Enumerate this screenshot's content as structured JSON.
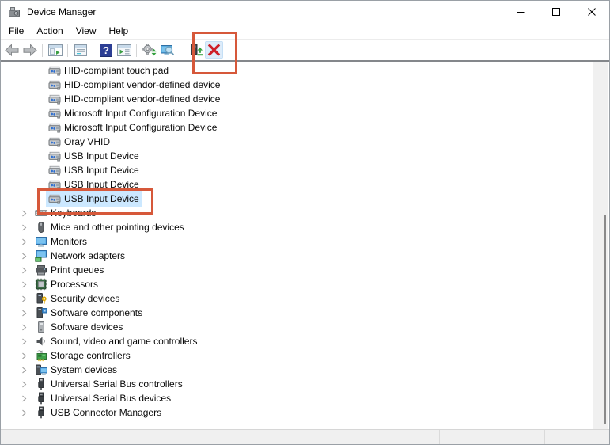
{
  "titlebar": {
    "title": "Device Manager",
    "app_icon": "device-manager",
    "controls": [
      {
        "icon": "minimize"
      },
      {
        "icon": "maximize"
      },
      {
        "icon": "close"
      }
    ]
  },
  "menubar": {
    "items": [
      "File",
      "Action",
      "View",
      "Help"
    ]
  },
  "toolbar": {
    "items": [
      {
        "type": "button",
        "icon": "back-arrow"
      },
      {
        "type": "button",
        "icon": "forward-arrow"
      },
      {
        "type": "separator"
      },
      {
        "type": "button",
        "icon": "console-tree"
      },
      {
        "type": "separator"
      },
      {
        "type": "button",
        "icon": "properties"
      },
      {
        "type": "separator"
      },
      {
        "type": "button",
        "icon": "help"
      },
      {
        "type": "button",
        "icon": "action-pane"
      },
      {
        "type": "separator"
      },
      {
        "type": "button",
        "icon": "scan-hardware"
      },
      {
        "type": "button",
        "icon": "remote-support"
      },
      {
        "type": "separator"
      },
      {
        "type": "button",
        "icon": "update-driver",
        "spaced": true
      },
      {
        "type": "button",
        "icon": "uninstall-device",
        "highlighted": true
      }
    ]
  },
  "tree": {
    "items": [
      {
        "label": "HID-compliant touch pad",
        "icon": "hid-device",
        "level": 2
      },
      {
        "label": "HID-compliant vendor-defined device",
        "icon": "hid-device",
        "level": 2
      },
      {
        "label": "HID-compliant vendor-defined device",
        "icon": "hid-device",
        "level": 2
      },
      {
        "label": "Microsoft Input Configuration Device",
        "icon": "hid-device",
        "level": 2
      },
      {
        "label": "Microsoft Input Configuration Device",
        "icon": "hid-device",
        "level": 2
      },
      {
        "label": "Oray VHID",
        "icon": "hid-device",
        "level": 2
      },
      {
        "label": "USB Input Device",
        "icon": "hid-device",
        "level": 2
      },
      {
        "label": "USB Input Device",
        "icon": "hid-device",
        "level": 2
      },
      {
        "label": "USB Input Device",
        "icon": "hid-device",
        "level": 2
      },
      {
        "label": "USB Input Device",
        "icon": "hid-device",
        "level": 2,
        "selected": true,
        "annotated": true
      },
      {
        "label": "Keyboards",
        "icon": "keyboard",
        "level": 1,
        "expandable": true
      },
      {
        "label": "Mice and other pointing devices",
        "icon": "mouse",
        "level": 1,
        "expandable": true
      },
      {
        "label": "Monitors",
        "icon": "monitor",
        "level": 1,
        "expandable": true
      },
      {
        "label": "Network adapters",
        "icon": "network-adapter",
        "level": 1,
        "expandable": true
      },
      {
        "label": "Print queues",
        "icon": "printer",
        "level": 1,
        "expandable": true
      },
      {
        "label": "Processors",
        "icon": "processor",
        "level": 1,
        "expandable": true
      },
      {
        "label": "Security devices",
        "icon": "security-device",
        "level": 1,
        "expandable": true
      },
      {
        "label": "Software components",
        "icon": "software-component",
        "level": 1,
        "expandable": true
      },
      {
        "label": "Software devices",
        "icon": "software-device",
        "level": 1,
        "expandable": true
      },
      {
        "label": "Sound, video and game controllers",
        "icon": "speaker",
        "level": 1,
        "expandable": true
      },
      {
        "label": "Storage controllers",
        "icon": "storage-controller",
        "level": 1,
        "expandable": true
      },
      {
        "label": "System devices",
        "icon": "system-device",
        "level": 1,
        "expandable": true
      },
      {
        "label": "Universal Serial Bus controllers",
        "icon": "usb",
        "level": 1,
        "expandable": true
      },
      {
        "label": "Universal Serial Bus devices",
        "icon": "usb",
        "level": 1,
        "expandable": true
      },
      {
        "label": "USB Connector Managers",
        "icon": "usb",
        "level": 1,
        "expandable": true
      }
    ]
  },
  "statusbar": {
    "panes": [
      "",
      "",
      ""
    ]
  },
  "colors": {
    "annotation": "#d6583a",
    "selection_bg": "#cce8ff",
    "uninstall_red": "#ce2029",
    "help_blue": "#2c3e94",
    "statusbar_bg": "#f0f0f0"
  }
}
